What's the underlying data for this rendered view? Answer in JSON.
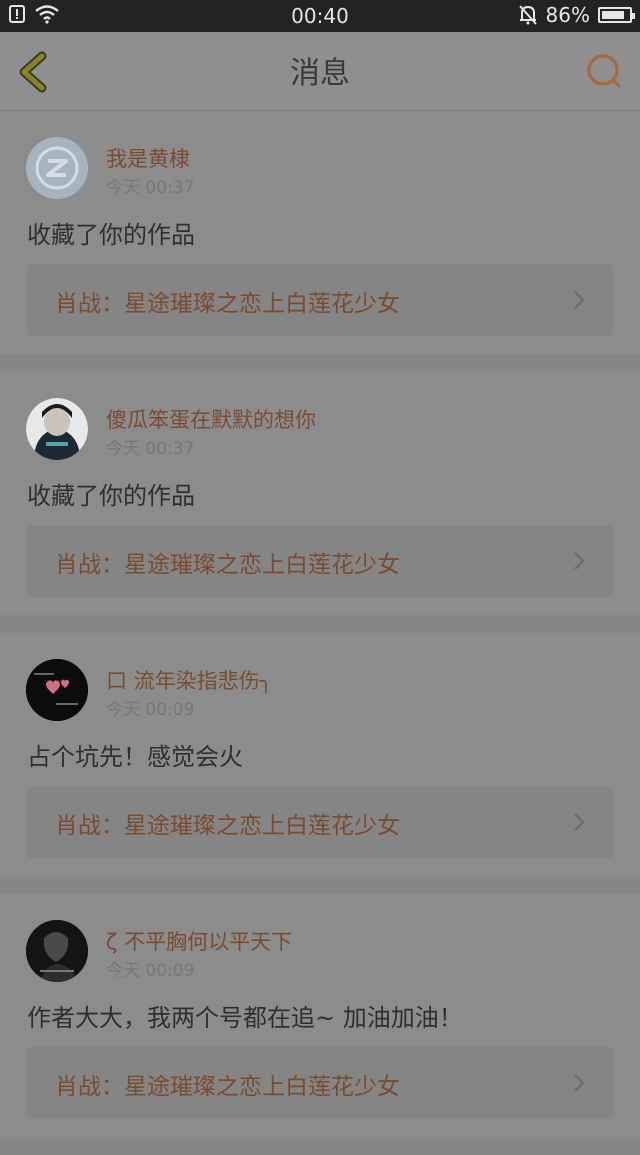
{
  "status_bar": {
    "time": "00:40",
    "battery": "86%",
    "battery_level": 0.86,
    "icons": [
      "sim-alert-icon",
      "wifi-icon",
      "bell-muted-icon",
      "battery-icon"
    ]
  },
  "nav": {
    "title": "消息",
    "back_icon": "chevron-left-icon",
    "search_icon": "search-icon"
  },
  "messages": [
    {
      "user": "我是黄棣",
      "time": "今天 00:37",
      "content": "收藏了你的作品",
      "work": "肖战：星途璀璨之恋上白莲花少女",
      "avatar": "default-qq-avatar"
    },
    {
      "user": "傻瓜笨蛋在默默的想你",
      "time": "今天 00:37",
      "content": "收藏了你的作品",
      "work": "肖战：星途璀璨之恋上白莲花少女",
      "avatar": "photo-avatar"
    },
    {
      "user": "口 流年染指悲伤╮",
      "time": "今天 00:09",
      "content": "占个坑先！感觉会火",
      "work": "肖战：星途璀璨之恋上白莲花少女",
      "avatar": "dark-hearts-avatar"
    },
    {
      "user": "ζ 不平胸何以平天下",
      "time": "今天 00:09",
      "content": "作者大大，我两个号都在追~ 加油加油！",
      "work": "肖战：星途璀璨之恋上白莲花少女",
      "avatar": "dark-photo-avatar"
    }
  ],
  "colors": {
    "accent": "#7b4b2f",
    "icon_accent": "#a86a3a"
  }
}
